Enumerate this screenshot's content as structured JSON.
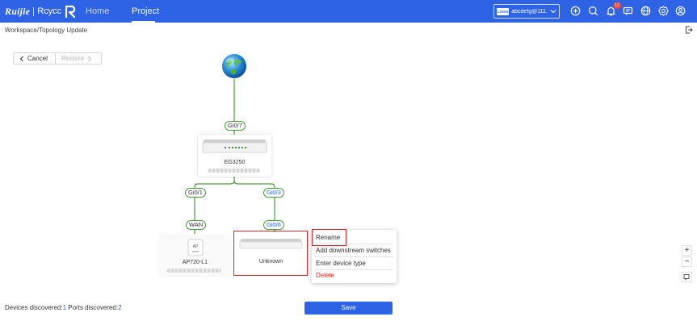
{
  "app": {
    "logo_brand": "Ruijie",
    "logo_product": "Rcycc"
  },
  "nav": {
    "items": [
      {
        "label": "Home",
        "active": false
      },
      {
        "label": "Project",
        "active": true
      }
    ]
  },
  "account": {
    "logo_text": "LOGO",
    "name": "abcdefg@111...."
  },
  "header_icons": [
    "add-circle-icon",
    "search-icon",
    "bell-icon",
    "message-icon",
    "globe-icon",
    "gear-icon",
    "user-icon"
  ],
  "notifications": {
    "count": "12"
  },
  "breadcrumb": "Workspace/Topology Update",
  "toolbar": {
    "cancel_label": "Cancel",
    "restore_label": "Restore"
  },
  "topology": {
    "internet_icon": "globe-icon",
    "gateway": {
      "uplink_port": "Gi0/7",
      "model": "EG3250"
    },
    "links": [
      {
        "gateway_port": "Gi0/1",
        "device_port": "WAN"
      },
      {
        "gateway_port": "Gi0/3",
        "device_port": "Gi0/6"
      }
    ],
    "ap": {
      "badge": "AP",
      "model": "AP720-L1"
    },
    "unknown_device": {
      "model": "Unknown"
    }
  },
  "context_menu": {
    "items": [
      {
        "label": "Rename",
        "danger": false
      },
      {
        "label": "Add downstream switches",
        "danger": false
      },
      {
        "label": "Enter device type",
        "danger": false
      },
      {
        "label": "Delete",
        "danger": true
      }
    ]
  },
  "zoom": {
    "in_label": "+",
    "out_label": "−"
  },
  "footer": {
    "devices_label": "Devices discovered:",
    "devices_count": "1",
    "ports_label": " Ports discovered:",
    "ports_count": "2",
    "save_label": "Save"
  },
  "colors": {
    "brand": "#2d63e4",
    "link": "#4a9a3c",
    "highlight": "#d0262c",
    "danger": "#e0302a"
  }
}
